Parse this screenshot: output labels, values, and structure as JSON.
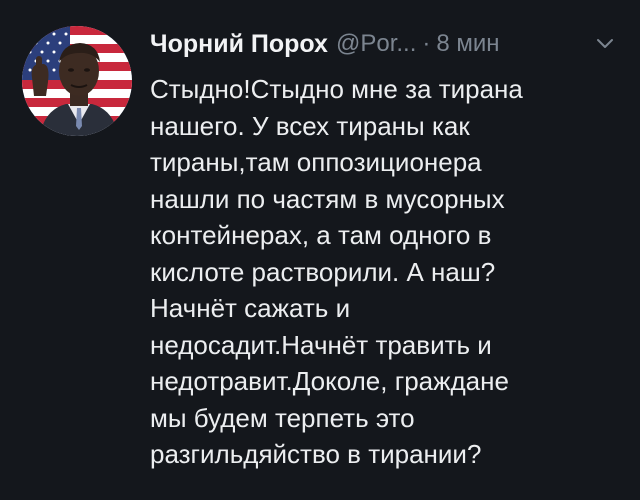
{
  "tweet": {
    "display_name": "Чорний Порох",
    "handle": "@Por...",
    "separator": "·",
    "time": "8 мин",
    "lines": [
      "Стыдно!Стыдно мне за тирана",
      "нашего. У всех тираны как",
      "тираны,там оппозиционера",
      "нашли по частям в мусорных",
      "контейнерах, а там одного в",
      "кислоте растворили. А наш?",
      "Начнёт сажать и",
      "недосадит.Начнёт травить и",
      "недотравит.Доколе, граждане",
      "мы будем терпеть это",
      "разгильдяйство в тирании?"
    ]
  },
  "icons": {
    "menu": "chevron-down-icon",
    "avatar": "avatar-flag-portrait"
  },
  "colors": {
    "background": "#14171c",
    "text": "#eceef0",
    "secondary": "#7c8590"
  }
}
